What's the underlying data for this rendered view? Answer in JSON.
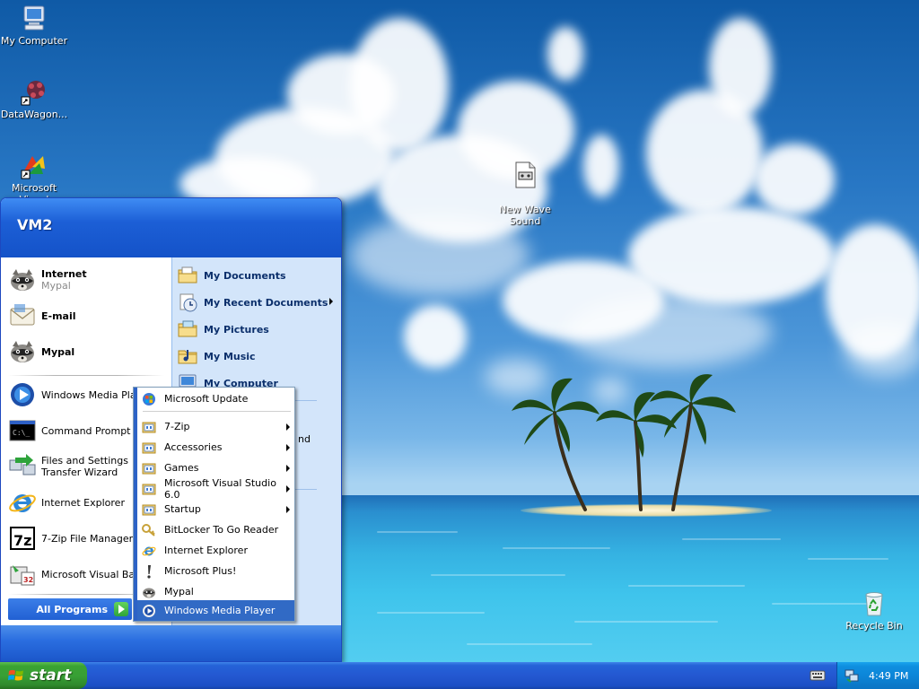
{
  "desktop": {
    "icons": {
      "my_computer": "My Computer",
      "datawagon": "DataWagon...",
      "ms_visual": "Microsoft Visual",
      "new_wave_sound": "New Wave\nSound",
      "recycle_bin": "Recycle Bin"
    }
  },
  "start_menu": {
    "user": "VM2",
    "pinned": [
      {
        "label": "Internet",
        "sub": "Mypal",
        "icon": "raccoon-icon"
      },
      {
        "label": "E-mail",
        "icon": "envelope-icon"
      },
      {
        "label": "Mypal",
        "icon": "raccoon-icon"
      }
    ],
    "recent": [
      {
        "label": "Windows Media Player",
        "icon": "media-player-icon"
      },
      {
        "label": "Command Prompt",
        "icon": "command-prompt-icon"
      },
      {
        "label": "Files and Settings Transfer Wizard",
        "icon": "transfer-wizard-icon"
      },
      {
        "label": "Internet Explorer",
        "icon": "internet-explorer-icon"
      },
      {
        "label": "7-Zip File Manager",
        "icon": "7zip-icon"
      },
      {
        "label": "Microsoft Visual Basic",
        "icon": "visual-basic-icon"
      }
    ],
    "all_programs": "All Programs",
    "right": [
      {
        "label": "My Documents",
        "icon": "folder-documents-icon"
      },
      {
        "label": "My Recent Documents",
        "icon": "recent-documents-icon"
      },
      {
        "label": "My Pictures",
        "icon": "folder-pictures-icon"
      },
      {
        "label": "My Music",
        "icon": "folder-music-icon"
      },
      {
        "label": "My Computer",
        "icon": "computer-icon"
      }
    ],
    "right_hidden_fragment": "nd"
  },
  "programs_menu": {
    "items": [
      {
        "label": "Microsoft Update",
        "icon": "windows-update-icon"
      },
      {
        "label": "7-Zip",
        "icon": "program-group-icon",
        "submenu": true
      },
      {
        "label": "Accessories",
        "icon": "program-group-icon",
        "submenu": true
      },
      {
        "label": "Games",
        "icon": "program-group-icon",
        "submenu": true
      },
      {
        "label": "Microsoft Visual Studio 6.0",
        "icon": "program-group-icon",
        "submenu": true
      },
      {
        "label": "Startup",
        "icon": "program-group-icon",
        "submenu": true
      },
      {
        "label": "BitLocker To Go Reader",
        "icon": "bitlocker-icon"
      },
      {
        "label": "Internet Explorer",
        "icon": "internet-explorer-icon"
      },
      {
        "label": "Microsoft Plus!",
        "icon": "microsoft-plus-icon"
      },
      {
        "label": "Mypal",
        "icon": "raccoon-icon"
      },
      {
        "label": "Windows Media Player",
        "icon": "media-player-icon",
        "highlighted": true
      }
    ]
  },
  "taskbar": {
    "start_label": "start",
    "clock": "4:49 PM"
  },
  "colors": {
    "taskbar_blue": "#2458d1",
    "start_green": "#38a035",
    "menu_highlight": "#316ac5",
    "right_pane": "#d3e5fa"
  }
}
